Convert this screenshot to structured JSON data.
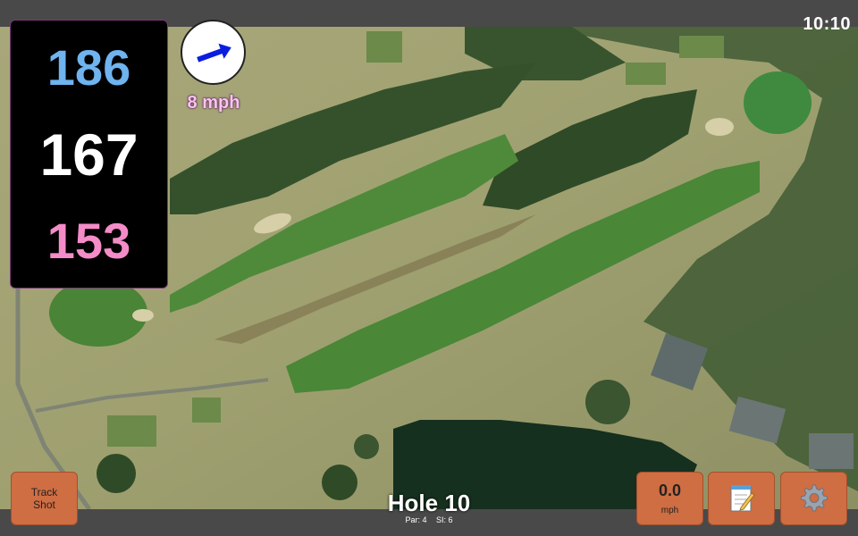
{
  "status_bar": {
    "time": "10:10"
  },
  "distances": {
    "back": "186",
    "middle": "167",
    "front": "153"
  },
  "wind": {
    "speed_label": "8 mph",
    "icon": "wind-arrow-icon"
  },
  "buttons": {
    "track_shot": {
      "line1": "Track",
      "line2": "Shot"
    },
    "speed": {
      "value": "0.0",
      "unit": "mph"
    },
    "notes": {
      "icon": "notepad-icon"
    },
    "settings": {
      "icon": "gear-icon"
    }
  },
  "hole": {
    "title": "Hole 10",
    "par": "Par: 4",
    "si": "SI: 6"
  },
  "colors": {
    "back_distance": "#6fb3ef",
    "middle_distance": "#ffffff",
    "front_distance": "#f48cc8",
    "button": "#cf6d43",
    "bar": "#494949"
  }
}
